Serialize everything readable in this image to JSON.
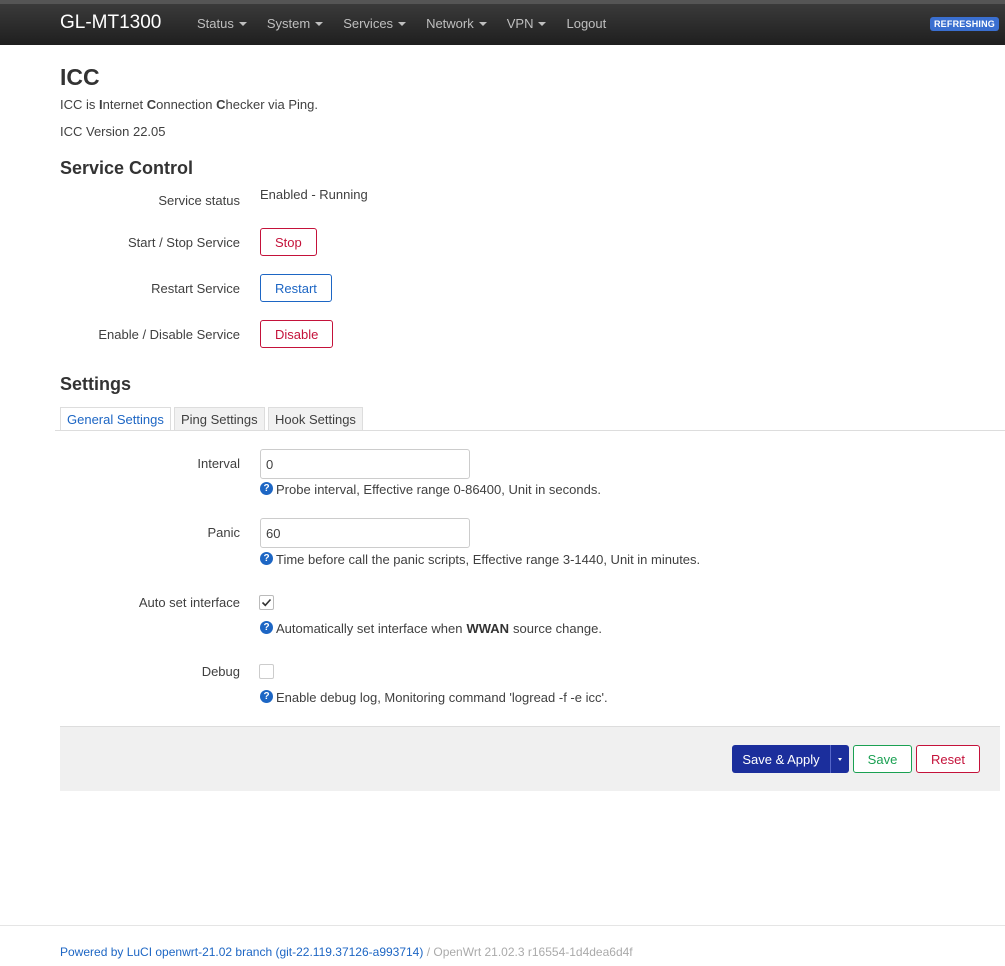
{
  "navbar": {
    "brand": "GL-MT1300",
    "items": [
      {
        "label": "Status",
        "dropdown": true
      },
      {
        "label": "System",
        "dropdown": true
      },
      {
        "label": "Services",
        "dropdown": true
      },
      {
        "label": "Network",
        "dropdown": true
      },
      {
        "label": "VPN",
        "dropdown": true
      },
      {
        "label": "Logout",
        "dropdown": false
      }
    ],
    "refresh_badge": "REFRESHING"
  },
  "page": {
    "title": "ICC",
    "description": {
      "prefix": "ICC is ",
      "i": "I",
      "i_rest": "nternet ",
      "c1": "C",
      "c1_rest": "onnection ",
      "c2": "C",
      "c2_rest": "hecker via Ping."
    },
    "version": "ICC Version 22.05"
  },
  "service_control": {
    "heading": "Service Control",
    "status_label": "Service status",
    "status_value": "Enabled - Running",
    "start_stop_label": "Start / Stop Service",
    "stop_button": "Stop",
    "restart_label": "Restart Service",
    "restart_button": "Restart",
    "enable_disable_label": "Enable / Disable Service",
    "disable_button": "Disable"
  },
  "settings": {
    "heading": "Settings",
    "tabs": [
      {
        "label": "General Settings",
        "active": true
      },
      {
        "label": "Ping Settings",
        "active": false
      },
      {
        "label": "Hook Settings",
        "active": false
      }
    ],
    "interval": {
      "label": "Interval",
      "value": "0",
      "help": "Probe interval, Effective range 0-86400, Unit in seconds."
    },
    "panic": {
      "label": "Panic",
      "value": "60",
      "help": "Time before call the panic scripts, Effective range 3-1440, Unit in minutes."
    },
    "auto_set_interface": {
      "label": "Auto set interface",
      "checked": true,
      "help_prefix": "Automatically set interface when ",
      "help_bold": "WWAN",
      "help_suffix": " source change."
    },
    "debug": {
      "label": "Debug",
      "checked": false,
      "help": "Enable debug log, Monitoring command 'logread -f -e icc'."
    }
  },
  "actions": {
    "save_apply": "Save & Apply",
    "save": "Save",
    "reset": "Reset"
  },
  "footer": {
    "link": "Powered by LuCI openwrt-21.02 branch (git-22.119.37126-a993714)",
    "separator": " / ",
    "version": "OpenWrt 21.02.3 r16554-1d4dea6d4f"
  },
  "colors": {
    "accent": "#1d66c4",
    "danger": "#c4123a",
    "success": "#1aa052",
    "primary": "#1b2e9c"
  }
}
